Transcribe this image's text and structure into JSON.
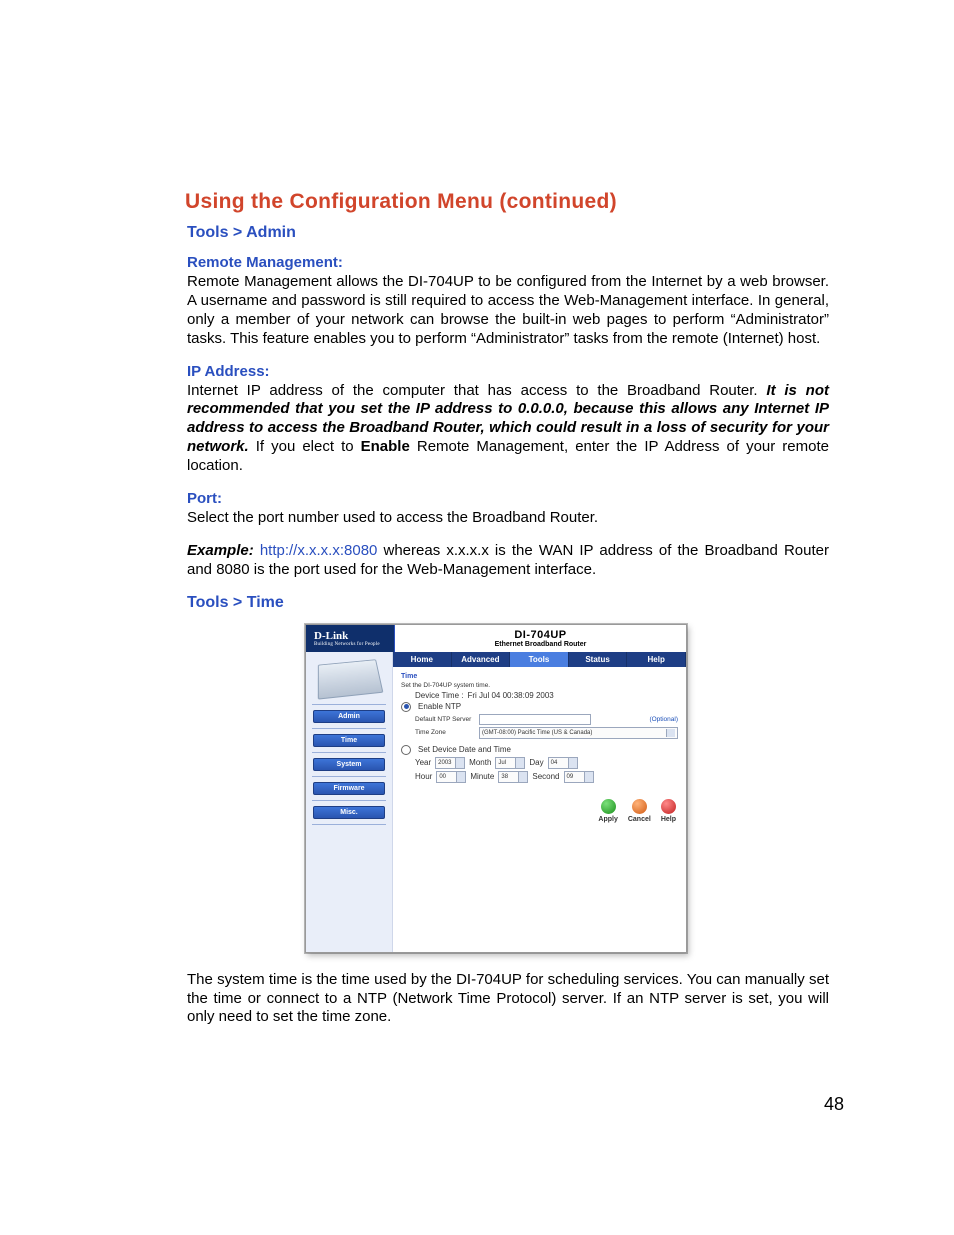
{
  "page": {
    "title": "Using the Configuration Menu (continued)",
    "number": "48"
  },
  "sections": {
    "admin_breadcrumb": "Tools > Admin",
    "remote_mgmt": {
      "heading": "Remote Management:",
      "text": "Remote Management allows the DI-704UP to be configured from the Internet by a web browser. A username and password is still required to access the Web-Management interface. In general, only a member of your network can browse the built-in web pages to perform “Administrator” tasks. This feature enables you to perform “Administrator” tasks from the remote (Internet) host."
    },
    "ip": {
      "heading": "IP Address:",
      "lead": "Internet IP address of the computer that has access to the Broadband Router. ",
      "warn": "It is not recommended that you set the IP address to 0.0.0.0, because this allows any Internet IP address to access the Broadband Router, which could result in a loss of security for your network.",
      "tail_a": " If you elect to ",
      "tail_b": "Enable",
      "tail_c": " Remote Management, enter the IP Address of your remote location."
    },
    "port": {
      "heading": "Port:",
      "text": "Select the port number used to access the Broadband Router."
    },
    "example": {
      "label": "Example:",
      "url": "http://x.x.x.x:8080",
      "tail": " whereas x.x.x.x is the WAN IP address of the Broadband Router and 8080 is the port used for the Web-Management interface."
    },
    "time_breadcrumb": "Tools > Time",
    "time_desc": "The system time is the time used by the DI-704UP for scheduling services. You can manually set the time or connect to a NTP (Network Time Protocol) server. If an NTP server is set, you will only need to set the time zone."
  },
  "screenshot": {
    "brand": "D-Link",
    "brand_tag": "Building Networks for People",
    "model": "DI-704UP",
    "model_sub": "Ethernet Broadband Router",
    "tabs": [
      "Home",
      "Advanced",
      "Tools",
      "Status",
      "Help"
    ],
    "active_tab": 2,
    "side_items": [
      "Admin",
      "Time",
      "System",
      "Firmware",
      "Misc."
    ],
    "panel": {
      "title": "Time",
      "subtitle": "Set the DI-704UP system time.",
      "device_time_label": "Device Time :",
      "device_time_value": "Fri Jul 04 00:38:09 2003",
      "enable_ntp": "Enable NTP",
      "ntp_server_label": "Default NTP Server",
      "ntp_optional": "(Optional)",
      "tz_label": "Time Zone",
      "tz_value": "(GMT-08:00) Pacific Time (US & Canada)",
      "set_dt": "Set Device Date and Time",
      "year_label": "Year",
      "year_value": "2003",
      "month_label": "Month",
      "month_value": "Jul",
      "day_label": "Day",
      "day_value": "04",
      "hour_label": "Hour",
      "hour_value": "00",
      "minute_label": "Minute",
      "minute_value": "38",
      "second_label": "Second",
      "second_value": "09",
      "actions": {
        "apply": "Apply",
        "cancel": "Cancel",
        "help": "Help"
      }
    }
  }
}
